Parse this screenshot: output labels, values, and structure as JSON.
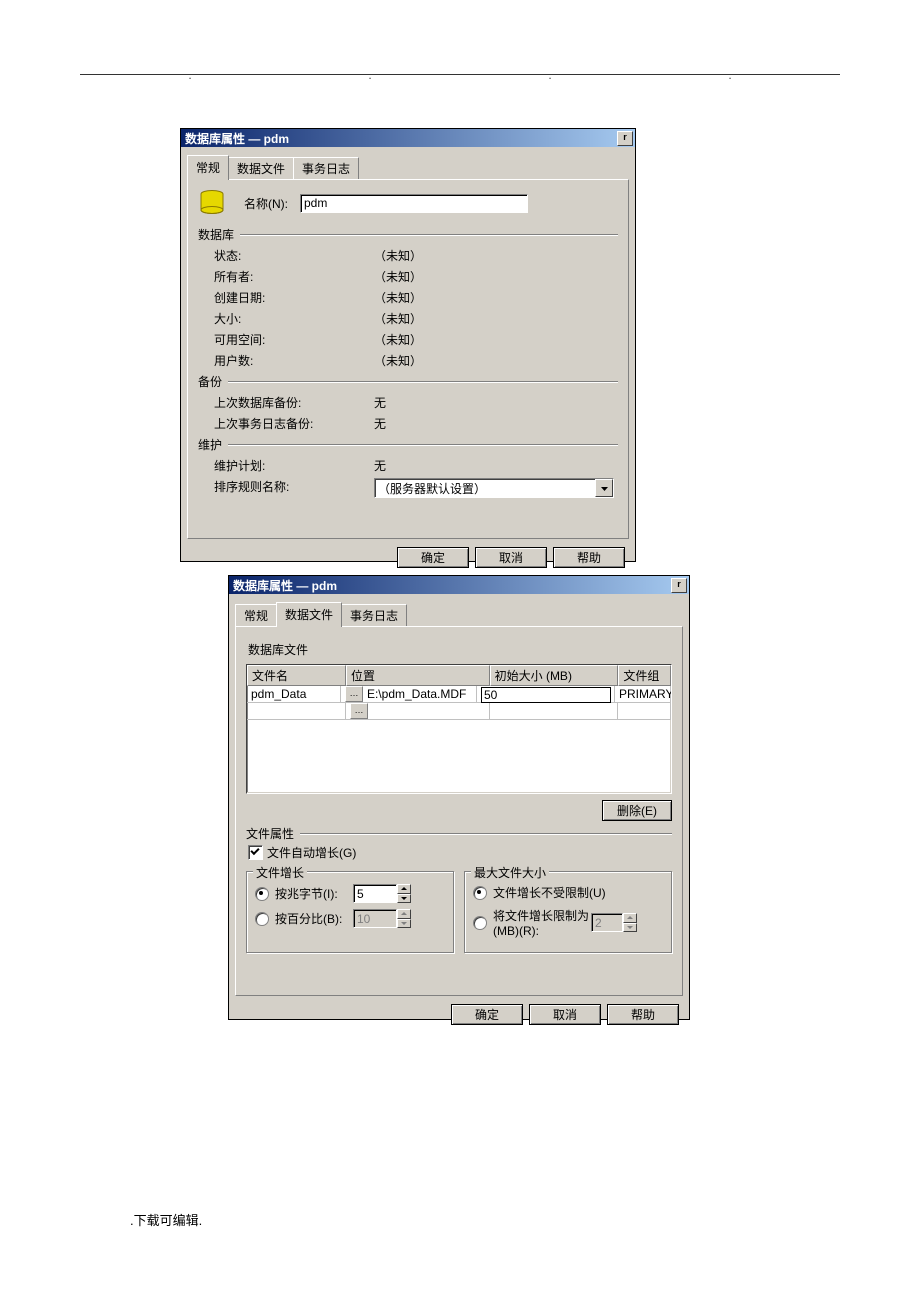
{
  "dialog1": {
    "title": "数据库属性 — pdm",
    "tabs": {
      "general": "常规",
      "data_files": "数据文件",
      "log": "事务日志"
    },
    "active_tab": "常规",
    "name_label": "名称(N):",
    "name_value": "pdm",
    "section_database": "数据库",
    "rows": {
      "status": {
        "k": "状态:",
        "v": "（未知）"
      },
      "owner": {
        "k": "所有者:",
        "v": "（未知）"
      },
      "created": {
        "k": "创建日期:",
        "v": "（未知）"
      },
      "size": {
        "k": "大小:",
        "v": "（未知）"
      },
      "available": {
        "k": "可用空间:",
        "v": "（未知）"
      },
      "users": {
        "k": "用户数:",
        "v": "（未知）"
      }
    },
    "section_backup": "备份",
    "backup_rows": {
      "last_db": {
        "k": "上次数据库备份:",
        "v": "无"
      },
      "last_log": {
        "k": "上次事务日志备份:",
        "v": "无"
      }
    },
    "section_maint": "维护",
    "maint_rows": {
      "plan": {
        "k": "维护计划:",
        "v": "无"
      },
      "collation": {
        "k": "排序规则名称:",
        "v": "（服务器默认设置）"
      }
    },
    "buttons": {
      "ok": "确定",
      "cancel": "取消",
      "help": "帮助"
    }
  },
  "dialog2": {
    "title": "数据库属性 — pdm",
    "tabs": {
      "general": "常规",
      "data_files": "数据文件",
      "log": "事务日志"
    },
    "active_tab": "数据文件",
    "section_label": "数据库文件",
    "grid": {
      "headers": {
        "filename": "文件名",
        "location": "位置",
        "initsize": "初始大小 (MB)",
        "filegroup": "文件组"
      },
      "row1": {
        "filename": "pdm_Data",
        "location": "E:\\pdm_Data.MDF",
        "initsize": "50",
        "filegroup": "PRIMARY"
      }
    },
    "delete_btn": "删除(E)",
    "file_props_label": "文件属性",
    "autogrow_label": "文件自动增长(G)",
    "growth_group": "文件增长",
    "by_mb_label": "按兆字节(I):",
    "by_mb_value": "5",
    "by_percent_label": "按百分比(B):",
    "by_percent_value": "10",
    "maxsize_group": "最大文件大小",
    "unrestricted_label": "文件增长不受限制(U)",
    "restrict_label": "将文件增长限制为 (MB)(R):",
    "restrict_value": "2",
    "buttons": {
      "ok": "确定",
      "cancel": "取消",
      "help": "帮助"
    }
  },
  "footer": ".下载可编辑."
}
